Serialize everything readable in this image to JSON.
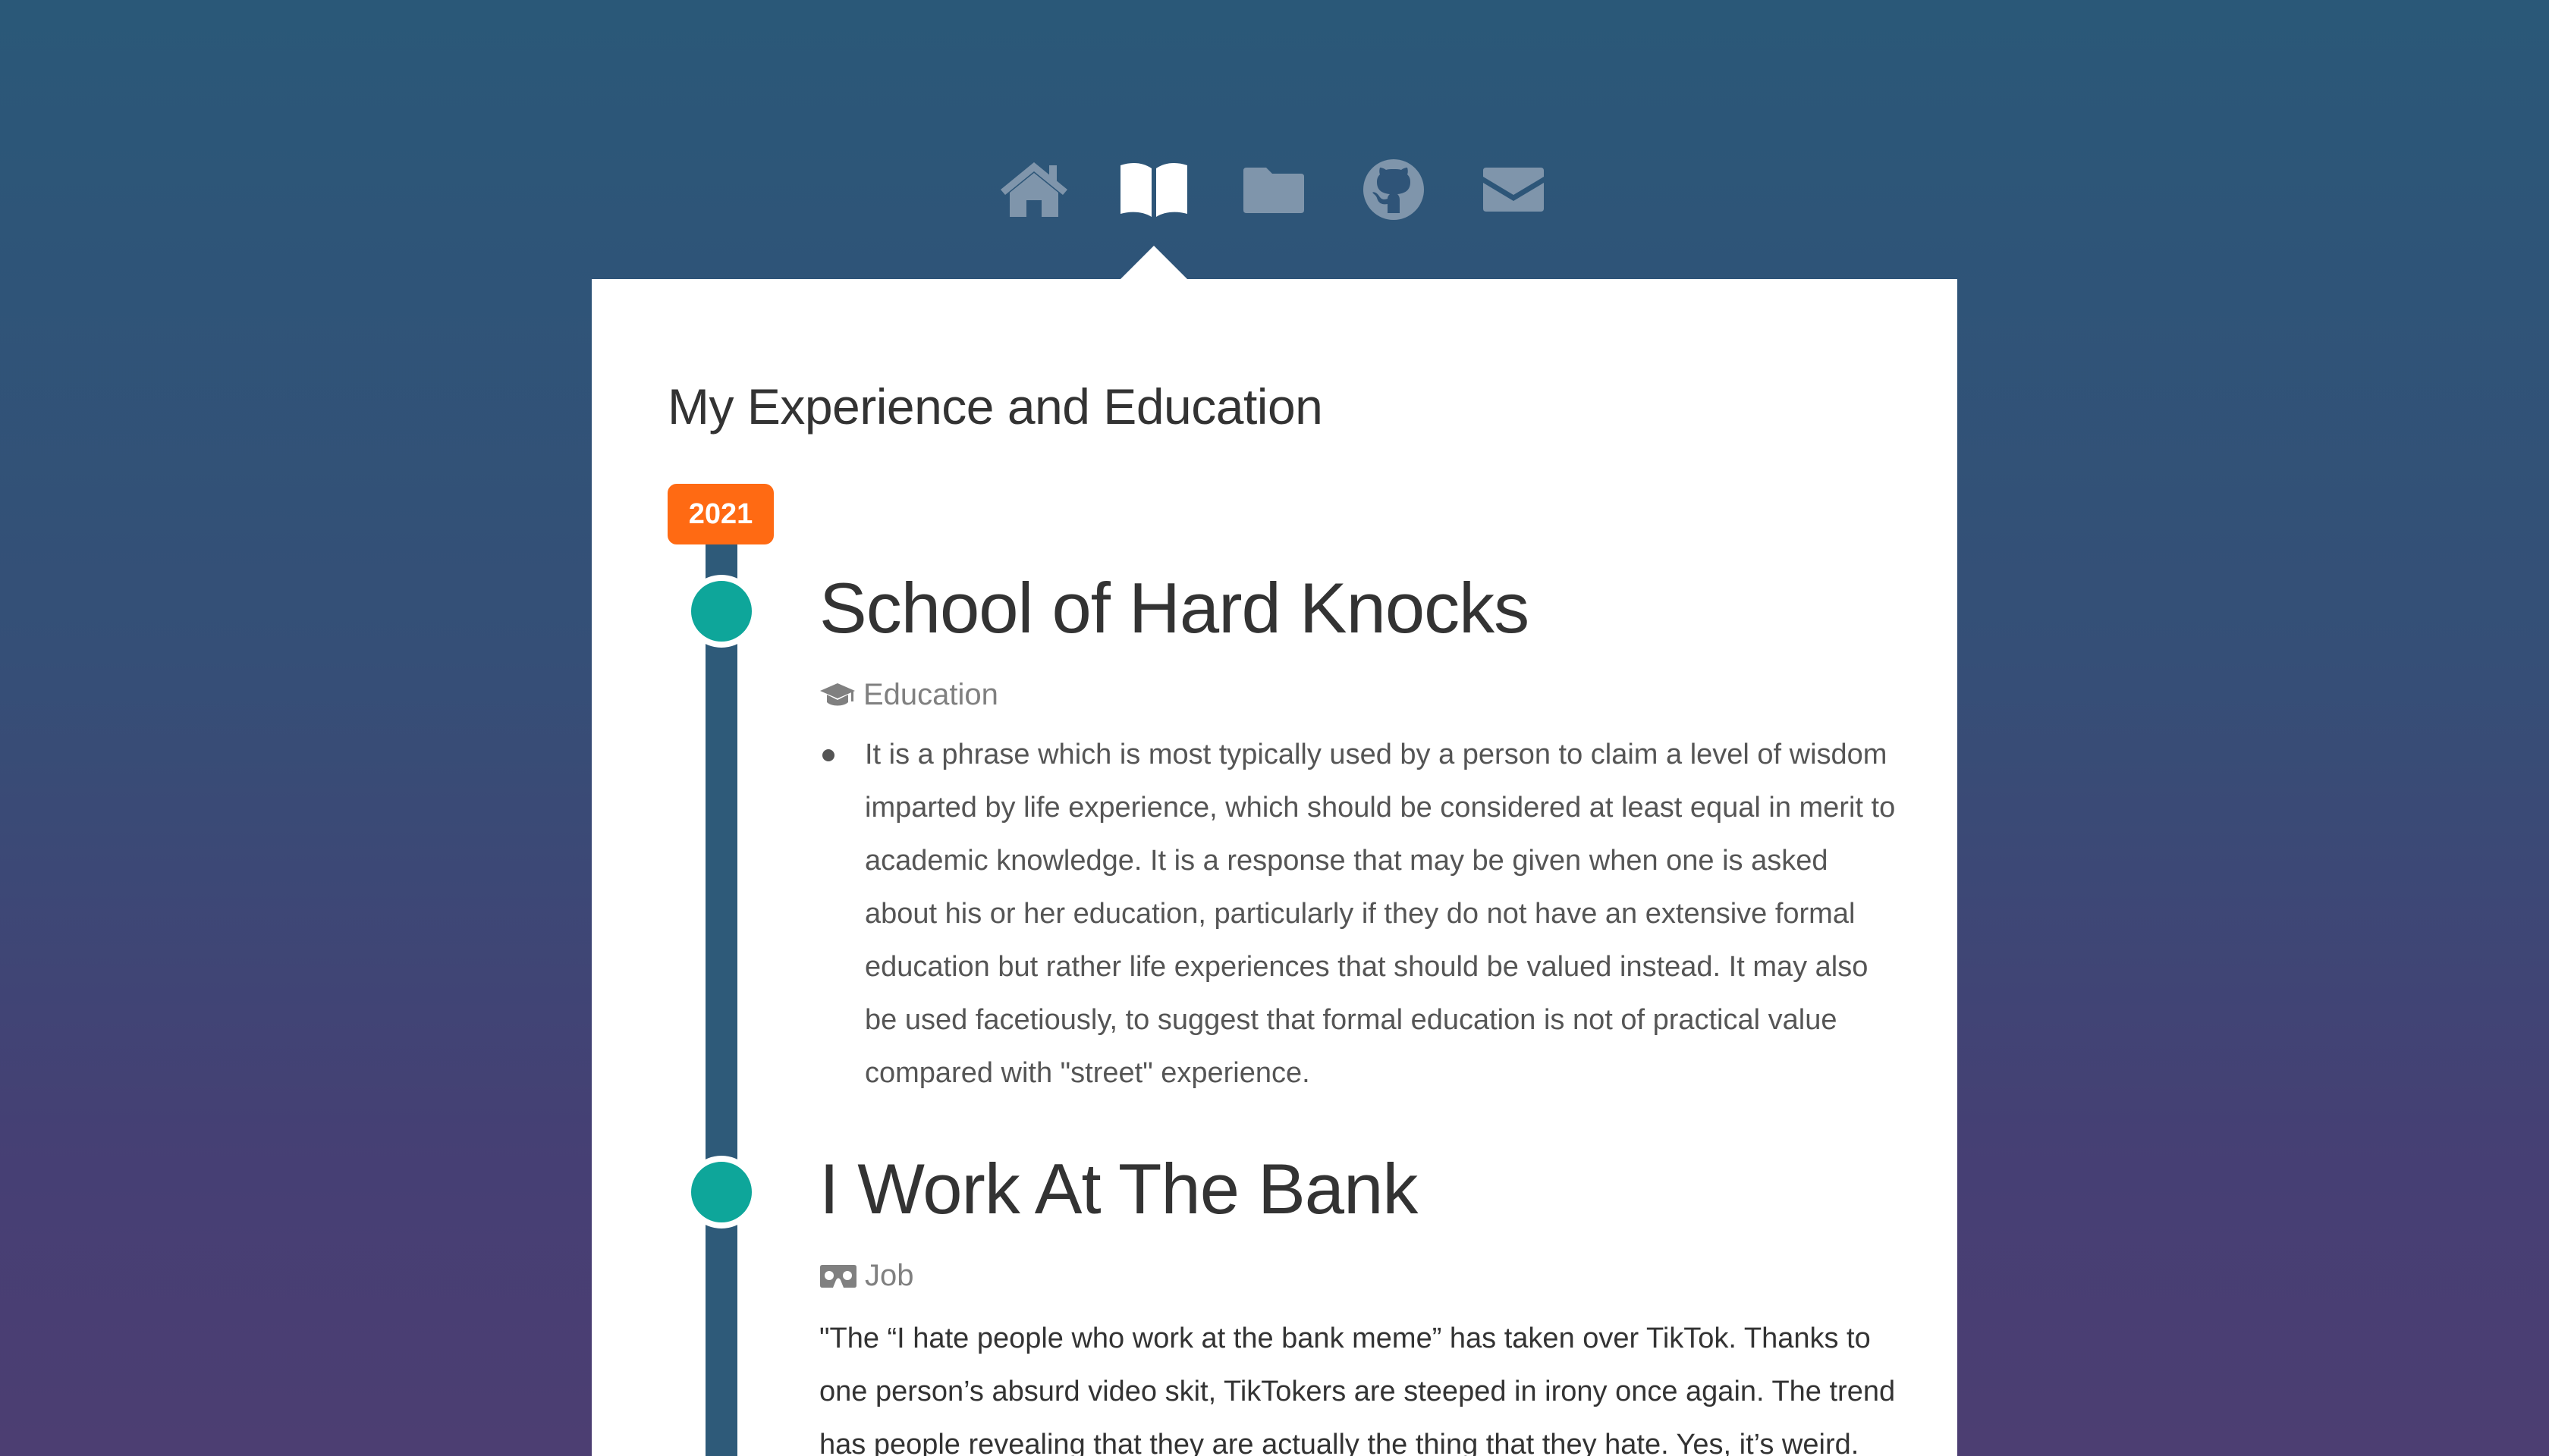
{
  "nav": {
    "items": [
      {
        "icon": "home-icon",
        "active": false
      },
      {
        "icon": "book-open-icon",
        "active": true
      },
      {
        "icon": "folder-icon",
        "active": false
      },
      {
        "icon": "github-icon",
        "active": false
      },
      {
        "icon": "envelope-icon",
        "active": false
      }
    ]
  },
  "page": {
    "title": "My Experience and Education"
  },
  "timeline": {
    "year": "2021",
    "entries": [
      {
        "title": "School of Hard Knocks",
        "type_icon": "graduation-cap-icon",
        "type": "Education",
        "bullet": "It is a phrase which is most typically used by a person to claim a level of wisdom imparted by life experience, which should be considered at least equal in merit to academic knowledge. It is a response that may be given when one is asked about his or her education, particularly if they do not have an extensive formal education but rather life experiences that should be valued instead. It may also be used facetiously, to suggest that formal education is not of practical value compared with \"street\" experience."
      },
      {
        "title": "I Work At The Bank",
        "type_icon": "vr-headset-icon",
        "type": "Job",
        "text": "\"The “I hate people who work at the bank meme” has taken over TikTok. Thanks to one person’s absurd video skit, TikTokers are steeped in irony once again. The trend has people revealing that they are actually the thing that they hate. Yes, it’s weird. But hey,"
      }
    ]
  },
  "colors": {
    "accent_orange": "#ff6a13",
    "timeline_dot": "#0ea69a",
    "timeline_line": "#2e5a79",
    "nav_inactive": "#7f95ab",
    "nav_active": "#ffffff"
  }
}
